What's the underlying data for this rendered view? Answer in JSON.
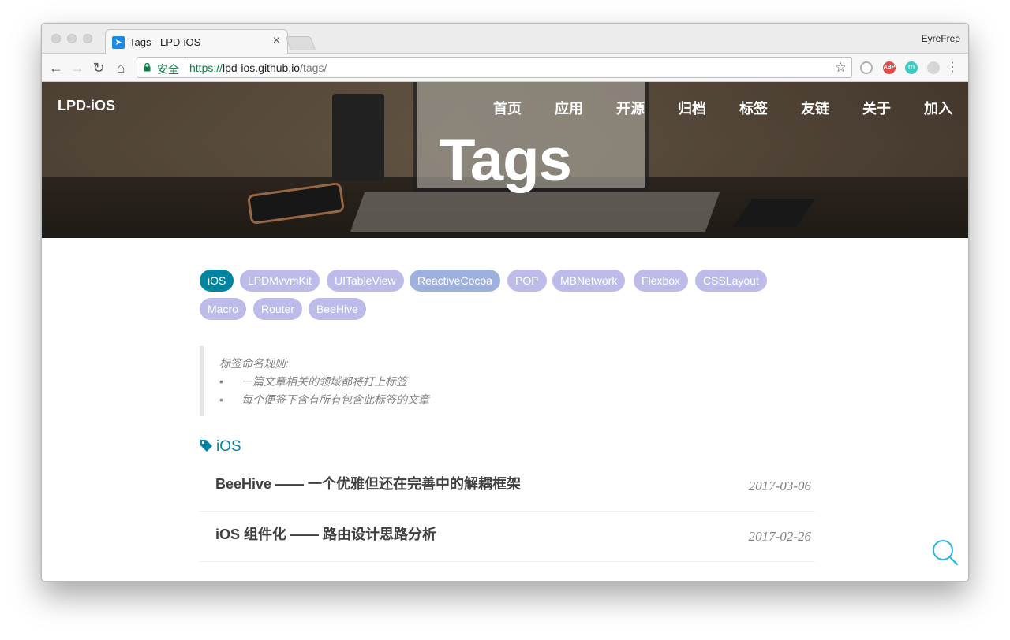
{
  "browser": {
    "tab_title": "Tags - LPD-iOS",
    "tab_close": "×",
    "profile_name": "EyreFree",
    "secure_label": "安全",
    "url_scheme": "https://",
    "url_host": "lpd-ios.github.io",
    "url_path": "/tags/",
    "extensions": [
      {
        "name": "circle-extension",
        "label": "",
        "color": "#b0b0b0"
      },
      {
        "name": "adblock-plus",
        "label": "ABP",
        "color": "#e34848"
      },
      {
        "name": "m-extension",
        "label": "m",
        "color": "#3cc9c0"
      },
      {
        "name": "link-extension",
        "label": "",
        "color": "#c8c8c8"
      }
    ]
  },
  "site": {
    "brand": "LPD-iOS",
    "nav": [
      "首页",
      "应用",
      "开源",
      "归档",
      "标签",
      "友链",
      "关于",
      "加入"
    ],
    "hero_title": "Tags"
  },
  "tags": [
    {
      "label": "iOS",
      "active": true,
      "color": "#0085a1"
    },
    {
      "label": "LPDMvvmKit",
      "active": false,
      "color": "#bdbbe9"
    },
    {
      "label": "UITableView",
      "active": false,
      "color": "#bdbbe9"
    },
    {
      "label": "ReactiveCocoa",
      "active": false,
      "color": "#9eb0dd"
    },
    {
      "label": "POP",
      "active": false,
      "color": "#bdbbe9"
    },
    {
      "label": "MBNetwork",
      "active": false,
      "color": "#bdbbe9"
    },
    {
      "label": "Flexbox",
      "active": false,
      "color": "#bdbbe9"
    },
    {
      "label": "CSSLayout",
      "active": false,
      "color": "#bdbbe9"
    },
    {
      "label": "Macro",
      "active": false,
      "color": "#bdbbe9"
    },
    {
      "label": "Router",
      "active": false,
      "color": "#bdbbe9"
    },
    {
      "label": "BeeHive",
      "active": false,
      "color": "#bdbbe9"
    }
  ],
  "rules": {
    "title": "标签命名规则:",
    "items": [
      "一篇文章相关的领域都将打上标签",
      "每个便签下含有所有包含此标签的文章"
    ]
  },
  "section": {
    "heading": "iOS"
  },
  "posts": [
    {
      "title": "BeeHive —— 一个优雅但还在完善中的解耦框架",
      "date": "2017-03-06"
    },
    {
      "title": "iOS 组件化 —— 路由设计思路分析",
      "date": "2017-02-26"
    }
  ]
}
